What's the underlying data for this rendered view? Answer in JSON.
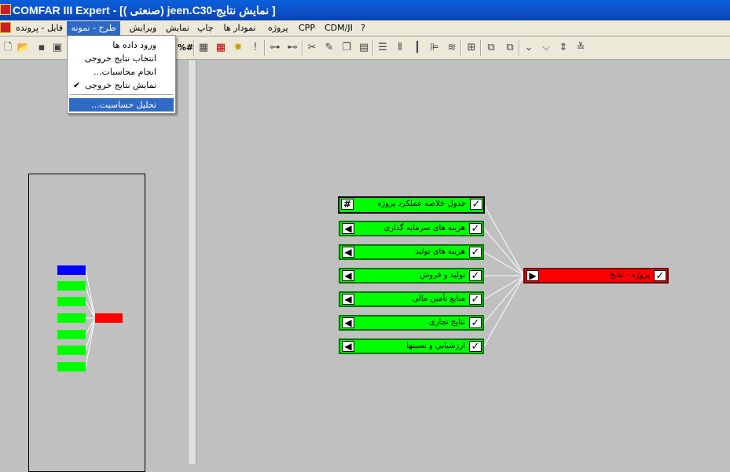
{
  "window": {
    "title": "COMFAR III Expert - [( صنعتی) jeen.C30-نمایش نتایج ]"
  },
  "menu": {
    "items": [
      {
        "label": "فایل - پرونده",
        "active": false
      },
      {
        "label": "طرح - نمونه",
        "active": true
      },
      {
        "label": "ویرایش",
        "active": false
      },
      {
        "label": "نمایش",
        "active": false
      },
      {
        "label": "چاپ",
        "active": false
      },
      {
        "label": "نمودار ها",
        "active": false
      },
      {
        "label": "پروژه",
        "active": false
      },
      {
        "label": "CPP",
        "active": false
      },
      {
        "label": "CDM/JI",
        "active": false
      },
      {
        "label": "?",
        "active": false
      }
    ]
  },
  "dropdown": {
    "items": [
      {
        "label": "ورود داده ها",
        "checked": false,
        "highlighted": false
      },
      {
        "label": "انتخاب نتایج خروجی",
        "checked": false,
        "highlighted": false
      },
      {
        "label": "انجام محاسبات...",
        "checked": false,
        "highlighted": false
      },
      {
        "label": "نمایش نتایج خروجی",
        "checked": true,
        "highlighted": false
      },
      {
        "label": "تحلیل حساسیت...",
        "checked": false,
        "highlighted": true
      }
    ]
  },
  "toolbar": {
    "icons": [
      "new-file-icon",
      "open-folder-icon",
      "save-icon",
      "number-format-icon",
      "grid-icon",
      "calculator-icon",
      "new-star-icon",
      "exclamation-icon",
      "tree-expand-icon",
      "tree-collapse-icon",
      "cut-icon",
      "edit-icon",
      "copy-icon",
      "paste-icon",
      "lines-icon",
      "columns-icon",
      "bars-icon",
      "align-icon",
      "slope-icon",
      "node-icon",
      "copy-node-icon",
      "paste-node-icon",
      "arrow-down-icon",
      "arrow-down-2-icon",
      "arrow-updown-icon",
      "arrow-double-icon"
    ]
  },
  "network": {
    "summary_node": {
      "label": "جدول خلاصه عملکرد پروژه",
      "icon": "#"
    },
    "nodes": [
      {
        "label": "هزینه های سرمایه گذاری"
      },
      {
        "label": "هزینه های تولید"
      },
      {
        "label": "تولید و فروش"
      },
      {
        "label": "منابع تأمین مالی"
      },
      {
        "label": "نتایج تجاری"
      },
      {
        "label": "ارزشیابی و نسبتها"
      }
    ],
    "result_node": {
      "label": "پروژه - نتایج"
    },
    "colors": {
      "node": "#00ff00",
      "result": "#ff0000",
      "overview_summary": "#0000ff"
    }
  }
}
